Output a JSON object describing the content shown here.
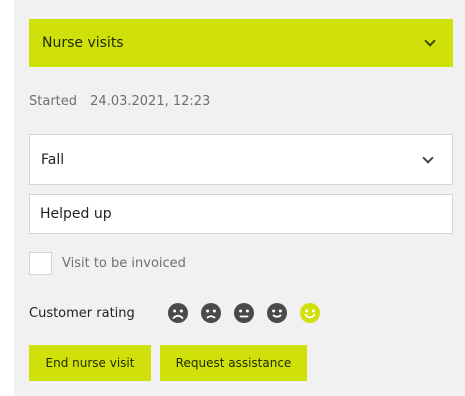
{
  "header": {
    "title": "Nurse visits",
    "expand_icon": "chevron-down-icon"
  },
  "started": {
    "label": "Started",
    "value": "24.03.2021, 12:23"
  },
  "category_select": {
    "value": "Fall",
    "icon": "chevron-down-icon"
  },
  "description_input": {
    "value": "Helped up",
    "placeholder": ""
  },
  "invoice_checkbox": {
    "label": "Visit to be invoiced",
    "checked": false
  },
  "rating": {
    "label": "Customer rating",
    "faces": [
      {
        "icon": "very-sad-face-icon",
        "color": "#4a4a4a",
        "selected": false
      },
      {
        "icon": "sad-face-icon",
        "color": "#4a4a4a",
        "selected": false
      },
      {
        "icon": "neutral-face-icon",
        "color": "#4a4a4a",
        "selected": false
      },
      {
        "icon": "content-face-icon",
        "color": "#4a4a4a",
        "selected": false
      },
      {
        "icon": "happy-face-icon",
        "color": "#cfe00a",
        "selected": true
      }
    ]
  },
  "actions": {
    "end_label": "End nurse visit",
    "assist_label": "Request assistance"
  },
  "colors": {
    "accent": "#cfe00a",
    "panel_bg": "#f1f1f1"
  }
}
